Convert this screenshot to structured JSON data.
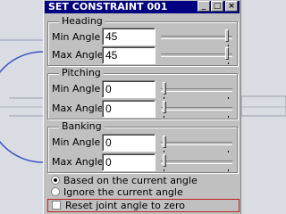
{
  "window": {
    "title": "SET CONSTRAINT 001"
  },
  "title_buttons": {
    "minimize": "_",
    "maximize": "□",
    "close": "×"
  },
  "heading": {
    "title": "Heading",
    "min_label": "Min Angle",
    "min_value": "45",
    "max_label": "Max Angle",
    "max_value": "45"
  },
  "pitching": {
    "title": "Pitching",
    "min_label": "Min Angle",
    "min_value": "0",
    "max_label": "Max Angle",
    "max_value": "0"
  },
  "banking": {
    "title": "Banking",
    "min_label": "Min Angle",
    "min_value": "0",
    "max_label": "Max Angle",
    "max_value": "0"
  },
  "options": {
    "based_on": "Based on the current angle",
    "ignore": "Ignore the current angle",
    "selected": "based_on"
  },
  "reset": {
    "label": "Reset joint angle to zero",
    "checked": false
  },
  "colors": {
    "titlebar": "#000080",
    "face": "#c0c0c0",
    "highlight_box": "#c02020"
  }
}
